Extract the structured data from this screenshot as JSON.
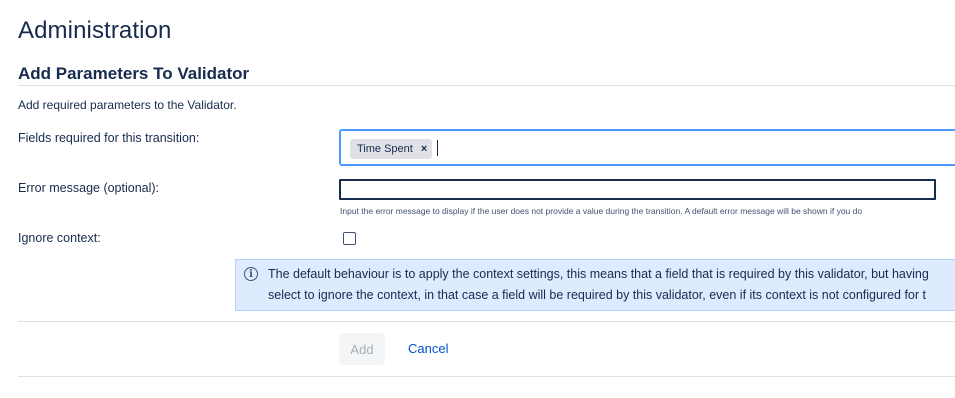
{
  "page": {
    "title": "Administration",
    "section_title": "Add Parameters To Validator",
    "description": "Add required parameters to the Validator."
  },
  "form": {
    "fields_required": {
      "label": "Fields required for this transition:",
      "selected_tags": [
        "Time Spent"
      ],
      "remove_glyph": "×"
    },
    "error_message": {
      "label": "Error message (optional):",
      "value": "",
      "help": "Input the error message to display if the user does not provide a value during the transition. A default error message will be shown if you do"
    },
    "ignore_context": {
      "label": "Ignore context:",
      "checked": false
    },
    "info": {
      "icon": "info-icon",
      "line1": "The default behaviour is to apply the context settings, this means that a field that is required by this validator, but having",
      "line2": "select to ignore the context, in that case a field will be required by this validator, even if its context is not configured for t"
    }
  },
  "actions": {
    "add_label": "Add",
    "cancel_label": "Cancel"
  },
  "colors": {
    "focus_border": "#4c9aff",
    "info_background": "#deebff",
    "link": "#0052cc",
    "disabled_text": "#a5adba"
  }
}
